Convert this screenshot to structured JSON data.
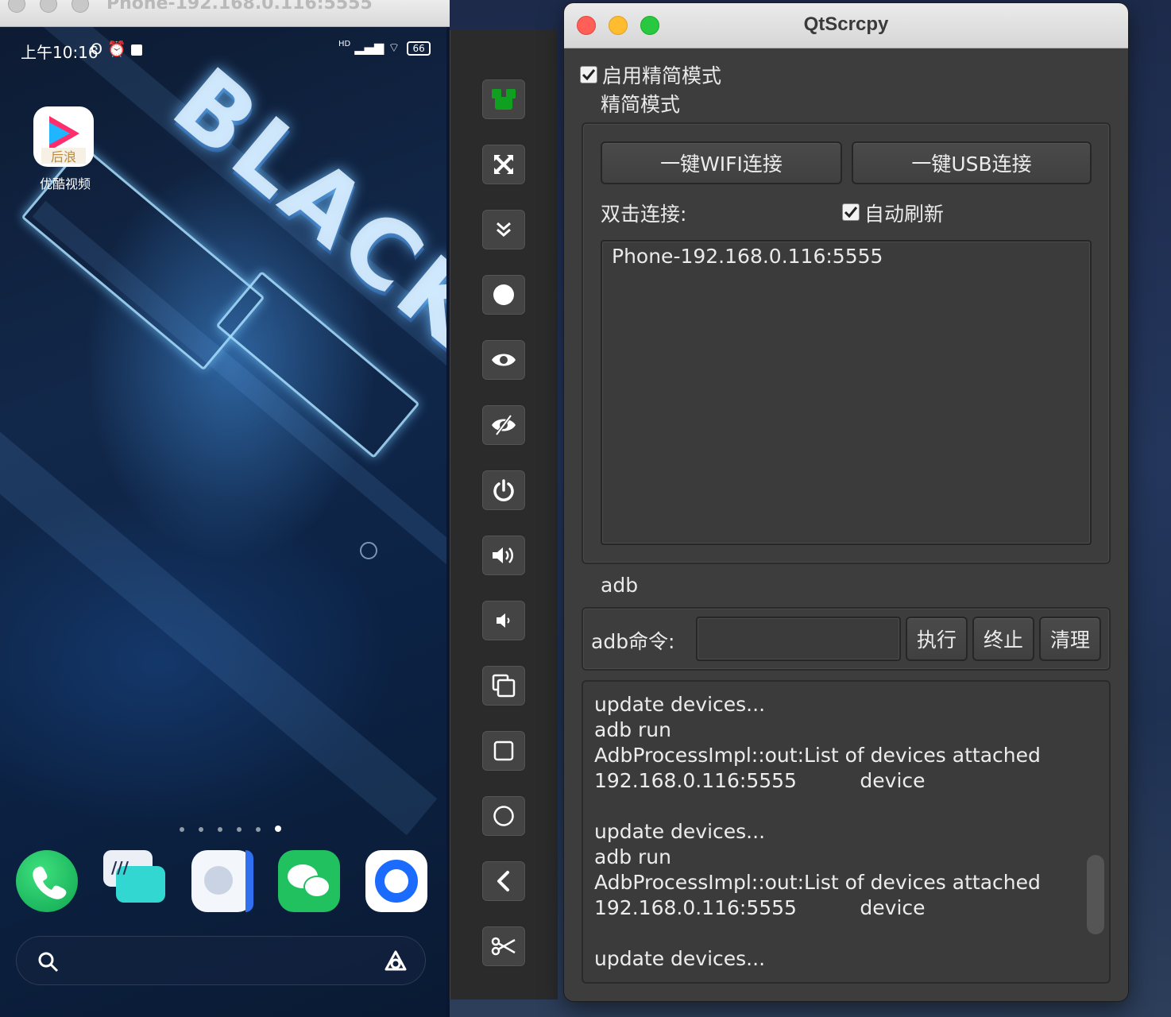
{
  "phone_window": {
    "title": "Phone-192.168.0.116:5555",
    "status_bar": {
      "time": "上午10:16",
      "signal": "HD",
      "battery": "66"
    },
    "home_apps": [
      {
        "label": "优酷视频",
        "icon": "youku-icon"
      }
    ],
    "wallpaper_text": "BLACK SHARK",
    "page_dots": {
      "count": 6,
      "active": 6
    },
    "dock": [
      "phone-icon",
      "messages-icon",
      "contacts-icon",
      "wechat-icon",
      "browser-icon"
    ],
    "search_bar": {
      "left_icon": "search-icon",
      "right_icon": "assistant-icon"
    }
  },
  "toolbar": {
    "buttons": [
      "switch-fullscreen-icon",
      "expand-icon",
      "collapse-icon",
      "record-icon",
      "show-touches-icon",
      "hide-screen-icon",
      "power-icon",
      "volume-up-icon",
      "volume-down-icon",
      "app-switch-icon",
      "home-icon",
      "back-circle-icon",
      "back-icon",
      "screenshot-icon"
    ]
  },
  "qt_window": {
    "title": "QtScrcpy",
    "simple_mode_checkbox": {
      "label": "启用精简模式",
      "checked": true
    },
    "simple_mode_group_title": "精简模式",
    "wifi_connect_button": "一键WIFI连接",
    "usb_connect_button": "一键USB连接",
    "double_click_label": "双击连接:",
    "auto_refresh_checkbox": {
      "label": "自动刷新",
      "checked": true
    },
    "device_list": [
      "Phone-192.168.0.116:5555"
    ],
    "adb_group_title": "adb",
    "adb_command_label": "adb命令:",
    "adb_command_value": "",
    "execute_button": "执行",
    "stop_button": "终止",
    "clear_button": "清理",
    "log": [
      "update devices...",
      "adb run",
      "AdbProcessImpl::out:List of devices attached",
      "192.168.0.116:5555          device",
      "",
      "update devices...",
      "adb run",
      "AdbProcessImpl::out:List of devices attached",
      "192.168.0.116:5555          device",
      "",
      "update devices..."
    ]
  }
}
